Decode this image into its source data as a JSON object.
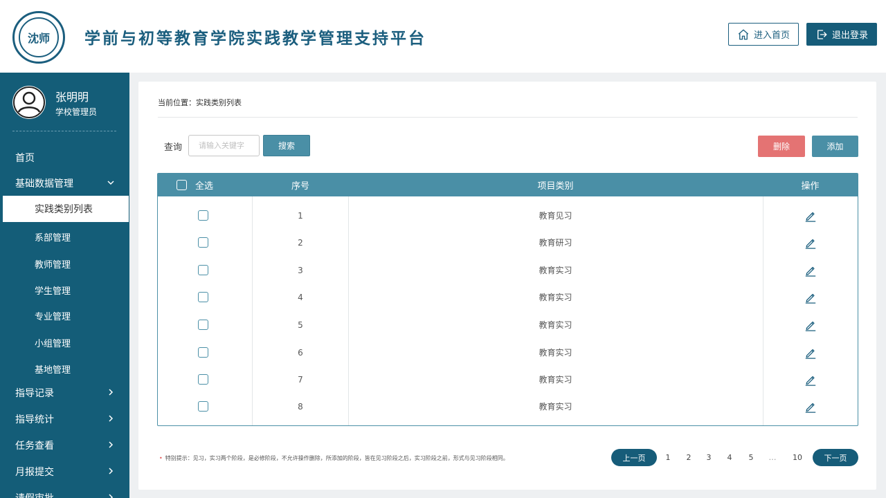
{
  "header": {
    "logo_text": "沈师",
    "title": "学前与初等教育学院实践教学管理支持平台",
    "home_label": "进入首页",
    "logout_label": "退出登录"
  },
  "user": {
    "name": "张明明",
    "role": "学校管理员"
  },
  "sidebar": {
    "items": [
      {
        "label": "首页"
      },
      {
        "label": "基础数据管理"
      },
      {
        "label": "指导记录"
      },
      {
        "label": "指导统计"
      },
      {
        "label": "任务查看"
      },
      {
        "label": "月报提交"
      },
      {
        "label": "请假审批"
      }
    ],
    "subitems": [
      {
        "label": "实践类别列表"
      },
      {
        "label": "系部管理"
      },
      {
        "label": "教师管理"
      },
      {
        "label": "学生管理"
      },
      {
        "label": "专业管理"
      },
      {
        "label": "小组管理"
      },
      {
        "label": "基地管理"
      }
    ]
  },
  "main": {
    "breadcrumb": "当前位置：实践类别列表",
    "query_label": "查询",
    "search_placeholder": "请输入关键字",
    "search_label": "搜索",
    "delete_label": "删除",
    "add_label": "添加"
  },
  "table": {
    "headers": {
      "select_all": "全选",
      "index": "序号",
      "category": "项目类别",
      "actions": "操作"
    },
    "rows": [
      {
        "index": "1",
        "category": "教育见习"
      },
      {
        "index": "2",
        "category": "教育研习"
      },
      {
        "index": "3",
        "category": "教育实习"
      },
      {
        "index": "4",
        "category": "教育实习"
      },
      {
        "index": "5",
        "category": "教育实习"
      },
      {
        "index": "6",
        "category": "教育实习"
      },
      {
        "index": "7",
        "category": "教育实习"
      },
      {
        "index": "8",
        "category": "教育实习"
      }
    ]
  },
  "footer": {
    "note": "特别提示：见习，实习两个阶段，是必修阶段，不允许操作删除，所添加的阶段，皆在见习阶段之后，实习阶段之前，形式与见习阶段相同。",
    "prev_label": "上一页",
    "next_label": "下一页",
    "pages": [
      "1",
      "2",
      "3",
      "4",
      "5",
      "10"
    ],
    "ellipsis": "…"
  },
  "icons": {
    "home": "home-icon",
    "logout": "logout-icon",
    "avatar": "user-avatar-icon",
    "chevron_down": "chevron-down-icon",
    "chevron_right": "chevron-right-icon",
    "edit": "edit-pencil-icon",
    "note_dot": "bullet-dot-icon"
  },
  "colors": {
    "primary": "#165c79",
    "table_header": "#4a8fa6",
    "danger": "#e47373",
    "background": "#eef0f2"
  }
}
